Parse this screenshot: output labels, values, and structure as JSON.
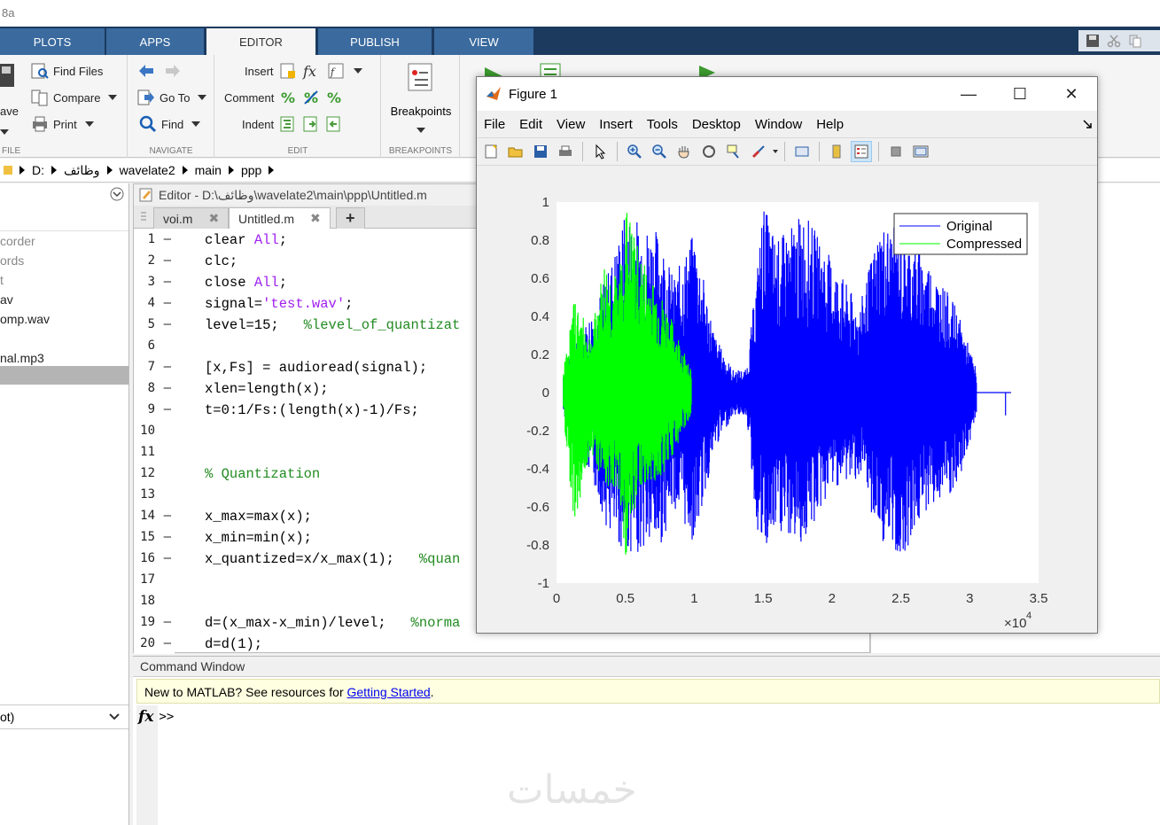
{
  "app": {
    "title_fragment": "8a"
  },
  "ribbon": {
    "tabs": [
      {
        "label": "PLOTS"
      },
      {
        "label": "APPS"
      },
      {
        "label": "EDITOR"
      },
      {
        "label": "PUBLISH"
      },
      {
        "label": "VIEW"
      }
    ],
    "file": {
      "save_label": "ave",
      "find_files": "Find Files",
      "compare": "Compare",
      "print": "Print",
      "section": "FILE"
    },
    "navigate": {
      "goto": "Go To",
      "find": "Find",
      "section": "NAVIGATE"
    },
    "edit": {
      "insert": "Insert",
      "comment": "Comment",
      "indent": "Indent",
      "section": "EDIT"
    },
    "breakpoints": {
      "label": "Breakpoints",
      "section": "BREAKPOINTS"
    }
  },
  "addressbar": {
    "crumbs": [
      "D:",
      "وظائف",
      "wavelate2",
      "main",
      "ppp"
    ]
  },
  "leftpanel": {
    "items": [
      "corder",
      "ords",
      "t",
      "av",
      "omp.wav",
      "nal.mp3"
    ],
    "bottom_select": "ot)"
  },
  "editor": {
    "title": "Editor - D:\\وظائف\\wavelate2\\main\\ppp\\Untitled.m",
    "tabs": [
      {
        "label": "voi.m"
      },
      {
        "label": "Untitled.m"
      }
    ],
    "add_tab": "+",
    "lines": [
      {
        "n": "1",
        "d": "–"
      },
      {
        "n": "2",
        "d": "–"
      },
      {
        "n": "3",
        "d": "–"
      },
      {
        "n": "4",
        "d": "–"
      },
      {
        "n": "5",
        "d": "–"
      },
      {
        "n": "6",
        "d": ""
      },
      {
        "n": "7",
        "d": "–"
      },
      {
        "n": "8",
        "d": "–"
      },
      {
        "n": "9",
        "d": "–"
      },
      {
        "n": "10",
        "d": ""
      },
      {
        "n": "11",
        "d": ""
      },
      {
        "n": "12",
        "d": ""
      },
      {
        "n": "13",
        "d": ""
      },
      {
        "n": "14",
        "d": "–"
      },
      {
        "n": "15",
        "d": "–"
      },
      {
        "n": "16",
        "d": "–"
      },
      {
        "n": "17",
        "d": ""
      },
      {
        "n": "18",
        "d": ""
      },
      {
        "n": "19",
        "d": "–"
      },
      {
        "n": "20",
        "d": "–"
      }
    ],
    "code": {
      "l1a": "clear ",
      "l1b": "All",
      "l1c": ";",
      "l2": "clc;",
      "l3a": "close ",
      "l3b": "All",
      "l3c": ";",
      "l4a": "signal=",
      "l4b": "'test.wav'",
      "l4c": ";",
      "l5a": "level=15;   ",
      "l5b": "%level_of_quantizat",
      "l7": "[x,Fs] = audioread(signal);",
      "l8": "xlen=length(x);",
      "l9": "t=0:1/Fs:(length(x)-1)/Fs;",
      "l12": "% Quantization",
      "l14": "x_max=max(x);",
      "l15": "x_min=min(x);",
      "l16a": "x_quantized=x/x_max(1);   ",
      "l16b": "%quan",
      "l19a": "d=(x_max-x_min)/level;   ",
      "l19b": "%norma",
      "l20": "d=d(1);"
    }
  },
  "command": {
    "title": "Command Window",
    "banner_text": "New to MATLAB? See resources for ",
    "banner_link": "Getting Started",
    "banner_end": ".",
    "fx": "fx",
    "prompt": ">>"
  },
  "watermark": "خمسات",
  "figure": {
    "title": "Figure 1",
    "menu": [
      "File",
      "Edit",
      "View",
      "Insert",
      "Tools",
      "Desktop",
      "Window",
      "Help"
    ],
    "controls": {
      "minimize": "—",
      "maximize": "☐",
      "close": "✕"
    }
  },
  "chart_data": {
    "type": "line",
    "xlim": [
      0,
      3.5
    ],
    "ylim": [
      -1,
      1
    ],
    "xticks": [
      "0",
      "0.5",
      "1",
      "1.5",
      "2",
      "2.5",
      "3",
      "3.5"
    ],
    "yticks": [
      "1",
      "0.8",
      "0.6",
      "0.4",
      "0.2",
      "0",
      "-0.2",
      "-0.4",
      "-0.6",
      "-0.8",
      "-1"
    ],
    "x_exponent_base": "×10",
    "x_exponent_power": "4",
    "legend_position": "top-right",
    "series": [
      {
        "name": "Original",
        "color": "#0000ff",
        "envelope": [
          {
            "x": 0.05,
            "hi": 0.12,
            "lo": -0.12
          },
          {
            "x": 0.3,
            "hi": 0.5,
            "lo": -0.55
          },
          {
            "x": 0.38,
            "hi": 0.65,
            "lo": -0.75
          },
          {
            "x": 0.5,
            "hi": 0.95,
            "lo": -0.85
          },
          {
            "x": 0.75,
            "hi": 0.85,
            "lo": -0.82
          },
          {
            "x": 0.85,
            "hi": 0.6,
            "lo": -0.6
          },
          {
            "x": 1.0,
            "hi": 0.85,
            "lo": -0.8
          },
          {
            "x": 1.15,
            "hi": 0.3,
            "lo": -0.3
          },
          {
            "x": 1.28,
            "hi": 0.12,
            "lo": -0.12
          },
          {
            "x": 1.38,
            "hi": 0.12,
            "lo": -0.12
          },
          {
            "x": 1.45,
            "hi": 0.6,
            "lo": -0.7
          },
          {
            "x": 1.5,
            "hi": 1.0,
            "lo": -0.88
          },
          {
            "x": 1.6,
            "hi": 0.8,
            "lo": -0.75
          },
          {
            "x": 1.8,
            "hi": 0.95,
            "lo": -0.8
          },
          {
            "x": 2.0,
            "hi": 0.7,
            "lo": -0.5
          },
          {
            "x": 2.2,
            "hi": 0.45,
            "lo": -0.45
          },
          {
            "x": 2.35,
            "hi": 0.9,
            "lo": -0.78
          },
          {
            "x": 2.5,
            "hi": 0.85,
            "lo": -0.88
          },
          {
            "x": 2.7,
            "hi": 0.7,
            "lo": -0.6
          },
          {
            "x": 2.9,
            "hi": 0.45,
            "lo": -0.55
          },
          {
            "x": 3.05,
            "hi": 0.12,
            "lo": -0.12
          }
        ],
        "tail_end": 3.3
      },
      {
        "name": "Compressed",
        "color": "#00ff00",
        "envelope": [
          {
            "x": 0.05,
            "hi": 0.12,
            "lo": -0.12
          },
          {
            "x": 0.13,
            "hi": 0.5,
            "lo": -0.7
          },
          {
            "x": 0.25,
            "hi": 0.3,
            "lo": -0.3
          },
          {
            "x": 0.35,
            "hi": 0.7,
            "lo": -0.5
          },
          {
            "x": 0.45,
            "hi": 0.6,
            "lo": -0.5
          },
          {
            "x": 0.5,
            "hi": 1.0,
            "lo": -0.88
          },
          {
            "x": 0.6,
            "hi": 0.75,
            "lo": -0.5
          },
          {
            "x": 0.7,
            "hi": 0.6,
            "lo": -0.5
          },
          {
            "x": 0.8,
            "hi": 0.45,
            "lo": -0.4
          },
          {
            "x": 0.98,
            "hi": 0.12,
            "lo": -0.12
          }
        ]
      }
    ]
  }
}
